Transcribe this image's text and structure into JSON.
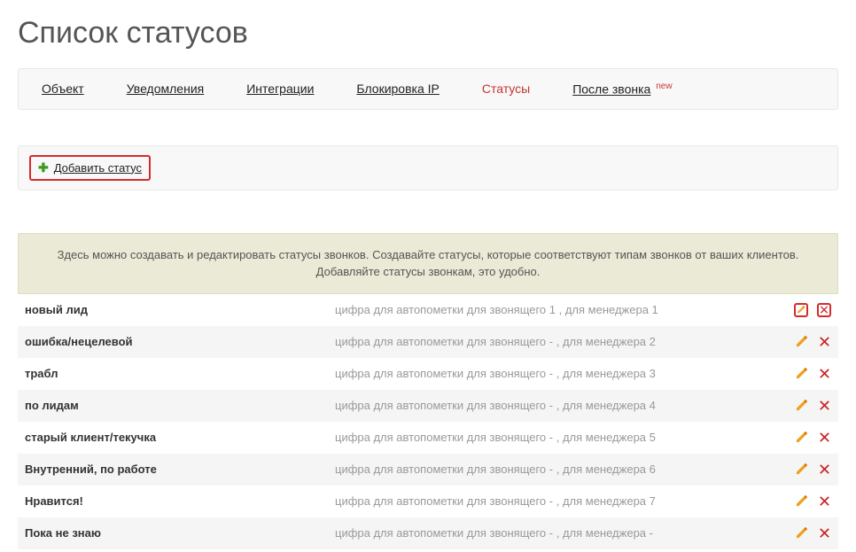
{
  "page_title": "Список статусов",
  "tabs": {
    "object": "Объект",
    "notifications": "Уведомления",
    "integrations": "Интеграции",
    "ip_block": "Блокировка IP",
    "statuses": "Статусы",
    "after_call": "После звонка",
    "after_call_badge": "new"
  },
  "add_status_label": "Добавить статус",
  "info_text": "Здесь можно создавать и редактировать статусы звонков. Создавайте статусы, которые соответствуют типам звонков от ваших клиентов. Добавляйте статусы звонкам, это удобно.",
  "meta_prefix": "цифра для автопометки для звонящего ",
  "meta_mid": " , для менеджера ",
  "rows": [
    {
      "name": "новый лид",
      "caller": "1",
      "manager": "1",
      "highlight": true
    },
    {
      "name": "ошибка/нецелевой",
      "caller": "-",
      "manager": "2",
      "highlight": false
    },
    {
      "name": "трабл",
      "caller": "-",
      "manager": "3",
      "highlight": false
    },
    {
      "name": "по лидам",
      "caller": "-",
      "manager": "4",
      "highlight": false
    },
    {
      "name": "старый клиент/текучка",
      "caller": "-",
      "manager": "5",
      "highlight": false
    },
    {
      "name": "Внутренний, по работе",
      "caller": "-",
      "manager": "6",
      "highlight": false
    },
    {
      "name": "Нравится!",
      "caller": "-",
      "manager": "7",
      "highlight": false
    },
    {
      "name": "Пока не знаю",
      "caller": "-",
      "manager": "-",
      "highlight": false
    }
  ]
}
